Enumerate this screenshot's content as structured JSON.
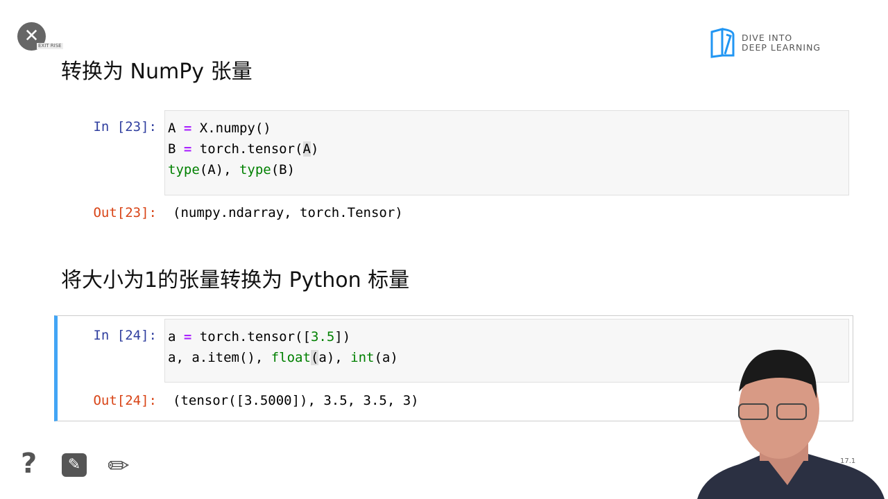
{
  "exit_button": {
    "label": "EXIT RISE",
    "icon": "close-icon"
  },
  "logo": {
    "line1": "DIVE INTO",
    "line2": "DEEP LEARNING",
    "color": "#2196F3"
  },
  "sections": [
    {
      "heading": "转换为 NumPy 张量",
      "in_prompt": "In [23]:",
      "code": [
        [
          [
            "A ",
            ""
          ],
          [
            "=",
            "op"
          ],
          [
            " X.numpy()",
            ""
          ]
        ],
        [
          [
            "B ",
            ""
          ],
          [
            "=",
            "op"
          ],
          [
            " torch.tensor(",
            ""
          ],
          [
            "A",
            "hl"
          ],
          [
            ")",
            ""
          ]
        ],
        [
          [
            "type",
            "bi"
          ],
          [
            "(A), ",
            ""
          ],
          [
            "type",
            "bi"
          ],
          [
            "(B)",
            ""
          ]
        ]
      ],
      "out_prompt": "Out[23]:",
      "output": "(numpy.ndarray, torch.Tensor)"
    },
    {
      "heading": "将大小为1的张量转换为 Python 标量",
      "in_prompt": "In [24]:",
      "code": [
        [
          [
            "a ",
            ""
          ],
          [
            "=",
            "op"
          ],
          [
            " torch.tensor([",
            ""
          ],
          [
            "3.5",
            "num"
          ],
          [
            "])",
            ""
          ]
        ],
        [
          [
            "a, a.item(), ",
            ""
          ],
          [
            "float",
            "bi"
          ],
          [
            "(",
            "hl"
          ],
          [
            "a), ",
            ""
          ],
          [
            "int",
            "bi"
          ],
          [
            "(a)",
            ""
          ]
        ]
      ],
      "out_prompt": "Out[24]:",
      "output": "(tensor([3.5000]), 3.5, 3.5, 3)"
    }
  ],
  "toolbar": {
    "help": "?",
    "slide_number": "17.1"
  }
}
